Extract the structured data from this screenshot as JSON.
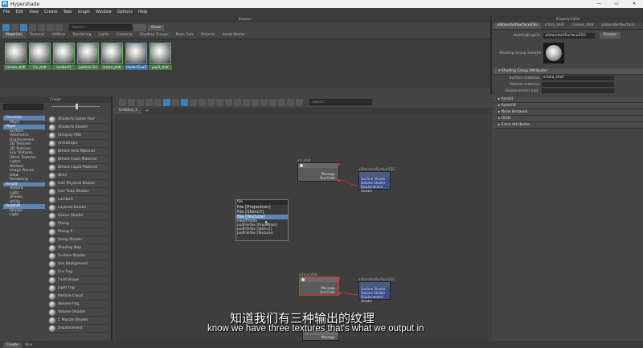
{
  "window": {
    "title": "Hypershade",
    "logo": "M",
    "controls": [
      "—",
      "▭",
      "✕"
    ]
  },
  "menu": [
    "File",
    "Edit",
    "View",
    "Create",
    "Tabs",
    "Graph",
    "Window",
    "Options",
    "Help"
  ],
  "browser": {
    "panel_title": "Browser",
    "search_placeholder": "Search...",
    "show_button": "Show",
    "tabs": [
      "Materials",
      "Textures",
      "Utilities",
      "Rendering",
      "Lights",
      "Cameras",
      "Shading Groups",
      "Bake Sets",
      "Projects",
      "Asset Nodes"
    ],
    "swatches": [
      {
        "label": "cornea_shdr",
        "style": "green"
      },
      {
        "label": "iris_shdr",
        "style": "green"
      },
      {
        "label": "lambert1",
        "style": "green"
      },
      {
        "label": "particle Clo",
        "style": "green"
      },
      {
        "label": "sclara_shdr",
        "style": "green"
      },
      {
        "label": "shaderGlow1",
        "style": "blue"
      },
      {
        "label": "pupil_shdr",
        "style": "green"
      }
    ]
  },
  "create": {
    "panel_title": "Create",
    "tree": [
      {
        "label": "Favorites",
        "indent": 1,
        "style": "hl"
      },
      {
        "label": "Maya",
        "indent": 2,
        "style": ""
      },
      {
        "label": "Maya",
        "indent": 1,
        "style": "hl"
      },
      {
        "label": "Surface",
        "indent": 2,
        "style": ""
      },
      {
        "label": "Volumetric",
        "indent": 2,
        "style": ""
      },
      {
        "label": "Displacement",
        "indent": 2,
        "style": ""
      },
      {
        "label": "2D Textures",
        "indent": 2,
        "style": ""
      },
      {
        "label": "3D Textures",
        "indent": 2,
        "style": ""
      },
      {
        "label": "Env Textures",
        "indent": 2,
        "style": ""
      },
      {
        "label": "Other Textures",
        "indent": 2,
        "style": ""
      },
      {
        "label": "Lights",
        "indent": 2,
        "style": ""
      },
      {
        "label": "Utilities",
        "indent": 2,
        "style": ""
      },
      {
        "label": "Image Planes",
        "indent": 2,
        "style": ""
      },
      {
        "label": "Glow",
        "indent": 2,
        "style": ""
      },
      {
        "label": "Rendering",
        "indent": 2,
        "style": ""
      },
      {
        "label": "Arnold",
        "indent": 1,
        "style": "hl"
      },
      {
        "label": "Texture",
        "indent": 2,
        "style": ""
      },
      {
        "label": "Light",
        "indent": 2,
        "style": ""
      },
      {
        "label": "Shader",
        "indent": 2,
        "style": ""
      },
      {
        "label": "Utility",
        "indent": 2,
        "style": ""
      },
      {
        "label": "Redshift",
        "indent": 1,
        "style": "hl"
      },
      {
        "label": "Shader",
        "indent": 2,
        "style": ""
      },
      {
        "label": "Light",
        "indent": 2,
        "style": ""
      }
    ],
    "shaders": [
      "Shaderfx Game Hair",
      "Shaderfx Shader",
      "Stingray PBS",
      "Anisotropic",
      "Bifrost Aero Material",
      "Bifrost Foam Material",
      "Bifrost Liquid Material",
      "Blinn",
      "Hair Physical Shader",
      "Hair Tube Shader",
      "Lambert",
      "Layered Shader",
      "Ocean Shader",
      "Phong",
      "Phong E",
      "Ramp Shader",
      "Shading Map",
      "Surface Shader",
      "Use Background",
      "Env Fog",
      "Fluid Shape",
      "Light Fog",
      "Particle Cloud",
      "Volume Fog",
      "Volume Shader",
      "C Muscle Shader",
      "Displacement"
    ]
  },
  "graph": {
    "search_placeholder": "Search...",
    "tab": "Untitled_1",
    "add_tab": "+",
    "nodes": [
      {
        "name": "iris_shdr",
        "rows": [
          "Message",
          "Out Color"
        ],
        "kind": "gray"
      },
      {
        "name": "aiStandardSurface2SG",
        "rows": [
          "Surface Shader",
          "Volume Shader",
          "Displacement Shader"
        ],
        "kind": "blue"
      },
      {
        "name": "sclara_shdr",
        "rows": [
          "Message",
          "Out Color"
        ],
        "kind": "gray"
      },
      {
        "name": "aiStandardSurface2SG",
        "rows": [
          "Surface Shader",
          "Volume Shader",
          "Displacement Shader"
        ],
        "kind": "blue"
      },
      {
        "name": "",
        "rows": [
          "Message"
        ],
        "kind": "gray"
      }
    ],
    "popup": {
      "input": "file",
      "items": [
        "file  [Projection]",
        "file  [Stencil]",
        "file  [Texture]",
        "colorProfile",
        "psdFileTex  [Projection]",
        "psdFileTex  [Stencil]",
        "psdFileTex  [Texture]"
      ],
      "highlighted": 2
    }
  },
  "property_editor": {
    "panel_title": "Property Editor",
    "tabs": [
      "aiStandardSurface2SG",
      "iclara_shdr",
      "cornea_shdr",
      "aiStandardSurface..."
    ],
    "shading_engine_label": "shadingEngine:",
    "shading_engine_value": "aiStandardSurface2SG",
    "presets_button": "Presets",
    "sample_label": "Shading Group Sample",
    "section_title": "Shading Group Attributes",
    "attributes": [
      {
        "label": "Surface material",
        "value": "sclara_shdr"
      },
      {
        "label": "Volume material",
        "value": ""
      },
      {
        "label": "Displacement mat.",
        "value": ""
      }
    ],
    "sections": [
      "Arnold",
      "Redshift",
      "Node Behavior",
      "UUID",
      "Extra Attributes"
    ]
  },
  "subtitles": {
    "cn": "知道我们有三种输出的纹理",
    "en": "know we have three textures that's what we output in"
  },
  "status_tabs": [
    "Create",
    "Bins"
  ],
  "colors": {
    "accent_blue": "#5d86b5",
    "connection_red": "#e03030",
    "node_blue": "#3d4d8a"
  }
}
